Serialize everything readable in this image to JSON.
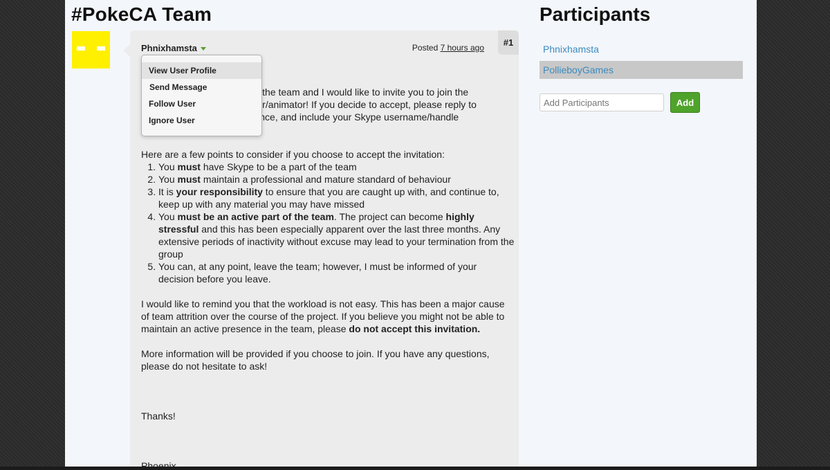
{
  "conversation": {
    "title": "#PokeCA Team"
  },
  "message": {
    "number": "#1",
    "author": "Phnixhamsta",
    "posted_label": "Posted",
    "posted_time": "7 hours ago",
    "intro_lines": [
      "cation, the team and I would like to invite you to join the",
      "nodeller/animator! If you decide to accept, please reply to",
      "cceptance, and include your Skype username/handle"
    ],
    "points_intro": "Here are a few points to consider if you choose to accept the invitation:",
    "points": [
      {
        "a": "You ",
        "b": "must",
        "c": " have Skype to be a part of the team"
      },
      {
        "a": "You ",
        "b": "must",
        "c": " maintain a professional and mature standard of behaviour"
      },
      {
        "a": "It is ",
        "b": "your responsibility",
        "c": " to ensure that you are caught up with, and continue to, keep up with any material you may have missed"
      },
      {
        "a": "You ",
        "b": "must be an active part of the team",
        "c": ". The project can become ",
        "d": "highly stressful",
        "e": " and this has been especially apparent over the last three months. Any extensive periods of inactivity without excuse may lead to your termination from the group"
      },
      {
        "a": "You can, at any point, leave the team; however, I must be informed of your decision before you leave."
      }
    ],
    "workload_text": "I would like to remind you that the workload is not easy. This has been a major cause of team attrition over the course of the project. If you believe you might not be able to maintain an active presence in the team, please ",
    "workload_bold": "do not accept this invitation.",
    "more_info": "More information will be provided if you choose to join. If you have any questions, please do not hesitate to ask!",
    "thanks": "Thanks!",
    "signature": "Phoenix"
  },
  "user_menu": {
    "items": [
      "View User Profile",
      "Send Message",
      "Follow User",
      "Ignore User"
    ],
    "hovered": "View User Profile"
  },
  "participants": {
    "title": "Participants",
    "list": [
      "Phnixhamsta",
      "PollieboyGames"
    ],
    "active": "PollieboyGames",
    "add_placeholder": "Add Participants",
    "add_button": "Add"
  },
  "colors": {
    "link": "#3b8bbf",
    "add_button": "#4fa32a",
    "avatar": "#fff000",
    "caret": "#5a9e2f"
  }
}
